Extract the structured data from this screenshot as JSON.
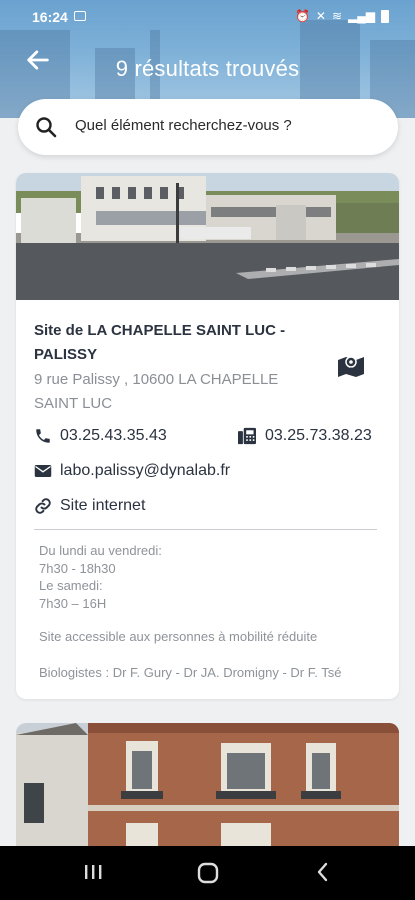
{
  "status_bar": {
    "time": "16:24"
  },
  "header": {
    "title": "9 résultats trouvés"
  },
  "search": {
    "placeholder": "Quel élément recherchez-vous ?"
  },
  "results": [
    {
      "name": "Site de LA CHAPELLE SAINT LUC - PALISSY",
      "address": "9 rue Palissy , 10600 LA CHAPELLE SAINT LUC",
      "phone": "03.25.43.35.43",
      "fax": "03.25.73.38.23",
      "email": "labo.palissy@dynalab.fr",
      "website_label": "Site internet",
      "hours": {
        "weekdays_label": "Du lundi au vendredi:",
        "weekdays_hours": "7h30 - 18h30",
        "saturday_label": "Le samedi:",
        "saturday_hours": "7h30 – 16H"
      },
      "accessibility": "Site accessible aux personnes à mobilité réduite",
      "biologists": "Biologistes : Dr F. Gury - Dr JA. Dromigny - Dr F. Tsé"
    }
  ],
  "colors": {
    "accent": "#2b3340",
    "muted": "#8e9399",
    "header": "#7fb1d8"
  }
}
